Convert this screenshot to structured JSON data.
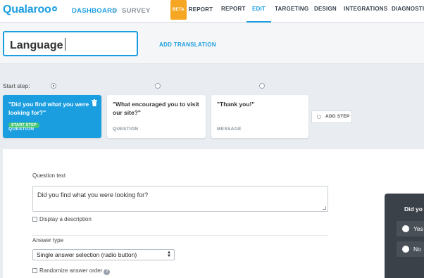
{
  "app": {
    "logo": "Qualaroo"
  },
  "breadcrumb": {
    "dashboard": "DASHBOARD",
    "separator": ">",
    "current": "SURVEY"
  },
  "nav": {
    "beta_badge": "BETA",
    "items": [
      "REPORT",
      "REPORT",
      "EDIT",
      "TARGETING",
      "DESIGN",
      "INTEGRATIONS",
      "DIAGNOSTICS"
    ],
    "active": "EDIT"
  },
  "language": {
    "value": "Language",
    "add_translation": "ADD TRANSLATION"
  },
  "steps": {
    "start_label": "Start step:",
    "items": [
      {
        "title": "\"Did you find what you were looking for?\"",
        "badge": "START STEP",
        "kind": "QUESTION"
      },
      {
        "title": "\"What encouraged you to visit our site?\"",
        "kind": "QUESTION"
      },
      {
        "title": "\"Thank you!\"",
        "kind": "MESSAGE"
      }
    ],
    "add_step": "ADD STEP"
  },
  "editor": {
    "question_label": "Question text",
    "question_value": "Did you find what you were looking for?",
    "display_description": "Display a description",
    "answer_type_label": "Answer type",
    "answer_type_value": "Single answer selection (radio button)",
    "randomize_label": "Randomize answer order",
    "help_glyph": "?"
  },
  "preview": {
    "question": "Did yo",
    "options": [
      "Yes",
      "No"
    ]
  },
  "colors": {
    "accent": "#1b9ee0",
    "badge_green": "#48c774",
    "beta_orange": "#f5a623",
    "preview_bg": "#3b4148"
  }
}
